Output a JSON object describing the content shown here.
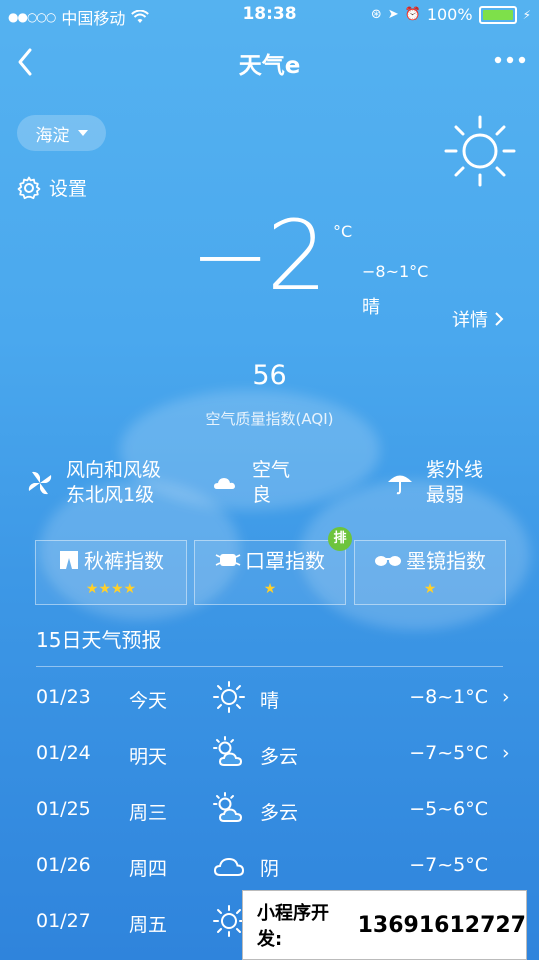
{
  "status": {
    "signal": "●●○○○",
    "carrier": "中国移动",
    "time": "18:38",
    "battery": "100%",
    "battery_level": 1.0
  },
  "nav": {
    "title": "天气e"
  },
  "location": "海淀",
  "settings_label": "设置",
  "current": {
    "temp": "−2",
    "unit": "°C",
    "range": "−8~1°C",
    "condition": "晴",
    "details_label": "详情"
  },
  "aqi": {
    "value": "56",
    "label": "空气质量指数(AQI)"
  },
  "info": [
    {
      "icon": "fan-icon",
      "title": "风向和风级",
      "value": "东北风1级"
    },
    {
      "icon": "cloud-icon",
      "title": "空气",
      "value": "良"
    },
    {
      "icon": "umbrella-icon",
      "title": "紫外线",
      "value": "最弱"
    }
  ],
  "indices": [
    {
      "icon": "long-johns-icon",
      "label": "秋裤指数",
      "stars": 4
    },
    {
      "icon": "mask-icon",
      "label": "口罩指数",
      "stars": 1
    },
    {
      "icon": "sunglasses-icon",
      "label": "墨镜指数",
      "stars": 1
    }
  ],
  "badge": "排",
  "forecast": {
    "title": "15日天气预报",
    "rows": [
      {
        "date": "01/23",
        "day": "今天",
        "icon": "sun-icon",
        "cond": "晴",
        "temp": "−8~1°C",
        "arrow": "›"
      },
      {
        "date": "01/24",
        "day": "明天",
        "icon": "partly-cloudy-icon",
        "cond": "多云",
        "temp": "−7~5°C",
        "arrow": "›"
      },
      {
        "date": "01/25",
        "day": "周三",
        "icon": "partly-cloudy-icon",
        "cond": "多云",
        "temp": "−5~6°C",
        "arrow": ""
      },
      {
        "date": "01/26",
        "day": "周四",
        "icon": "cloud-icon",
        "cond": "阴",
        "temp": "−7~5°C",
        "arrow": ""
      },
      {
        "date": "01/27",
        "day": "周五",
        "icon": "sun-icon",
        "cond": "",
        "temp": "",
        "arrow": ""
      }
    ]
  },
  "promo": {
    "label": "小程序开发:",
    "phone": "13691612727"
  },
  "colors": {
    "background_top": "#55b2f0",
    "background_bottom": "#2f84dc",
    "star": "#ffd02b",
    "badge": "#6dc43d",
    "battery": "#7ee04a"
  }
}
